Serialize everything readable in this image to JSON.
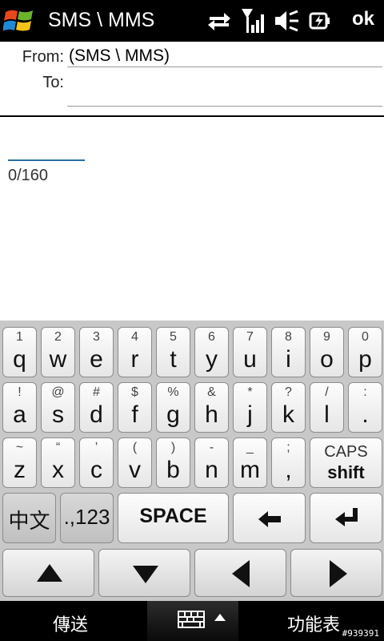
{
  "titlebar": {
    "title": "SMS \\ MMS",
    "ok_label": "ok"
  },
  "header": {
    "from_label": "From:",
    "from_value": "(SMS \\ MMS)",
    "to_label": "To:",
    "to_value": ""
  },
  "message": {
    "counter": "0/160"
  },
  "keyboard": {
    "row1": [
      {
        "num": "1",
        "chr": "q"
      },
      {
        "num": "2",
        "chr": "w"
      },
      {
        "num": "3",
        "chr": "e"
      },
      {
        "num": "4",
        "chr": "r"
      },
      {
        "num": "5",
        "chr": "t"
      },
      {
        "num": "6",
        "chr": "y"
      },
      {
        "num": "7",
        "chr": "u"
      },
      {
        "num": "8",
        "chr": "i"
      },
      {
        "num": "9",
        "chr": "o"
      },
      {
        "num": "0",
        "chr": "p"
      }
    ],
    "row2": [
      {
        "num": "!",
        "chr": "a"
      },
      {
        "num": "@",
        "chr": "s"
      },
      {
        "num": "#",
        "chr": "d"
      },
      {
        "num": "$",
        "chr": "f"
      },
      {
        "num": "%",
        "chr": "g"
      },
      {
        "num": "&",
        "chr": "h"
      },
      {
        "num": "*",
        "chr": "j"
      },
      {
        "num": "?",
        "chr": "k"
      },
      {
        "num": "/",
        "chr": "l"
      },
      {
        "num": ":",
        "chr": "."
      }
    ],
    "row3": [
      {
        "num": "~",
        "chr": "z"
      },
      {
        "num": "“",
        "chr": "x"
      },
      {
        "num": "’",
        "chr": "c"
      },
      {
        "num": "(",
        "chr": "v"
      },
      {
        "num": ")",
        "chr": "b"
      },
      {
        "num": "-",
        "chr": "n"
      },
      {
        "num": "_",
        "chr": "m"
      },
      {
        "num": ";",
        "chr": ","
      }
    ],
    "caps_top": "CAPS",
    "caps_bottom": "shift",
    "lang_label": "中文",
    "symbols_label": ".,123",
    "space_label": "SPACE",
    "backspace_symbol": "←",
    "enter_symbol": "↵"
  },
  "softkeys": {
    "left": "傳送",
    "right": "功能表"
  },
  "watermark": "#939391"
}
